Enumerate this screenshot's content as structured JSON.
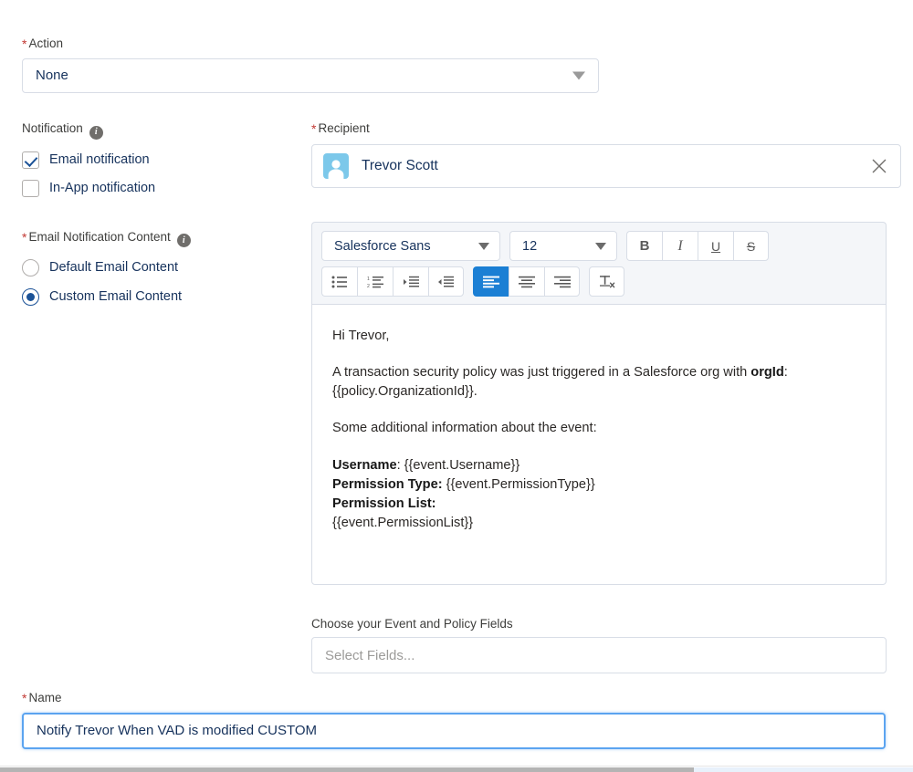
{
  "action": {
    "label": "Action",
    "required": true,
    "value": "None"
  },
  "notification": {
    "label": "Notification",
    "info_icon": "info-icon",
    "options": [
      {
        "label": "Email notification",
        "checked": true
      },
      {
        "label": "In-App notification",
        "checked": false
      }
    ]
  },
  "email_notification_content": {
    "label": "Email Notification Content",
    "required": true,
    "info_icon": "info-icon",
    "options": [
      {
        "label": "Default Email Content",
        "selected": false
      },
      {
        "label": "Custom Email Content",
        "selected": true
      }
    ]
  },
  "recipient": {
    "label": "Recipient",
    "required": true,
    "value": "Trevor Scott",
    "avatar_icon": "user-avatar-icon",
    "clear_icon": "close-icon"
  },
  "editor": {
    "font_family": "Salesforce Sans",
    "font_size": "12",
    "toolbar": {
      "bold": "B",
      "italic": "I",
      "underline": "U",
      "strikethrough": "S",
      "bulleted_list": "bulleted-list-icon",
      "numbered_list": "numbered-list-icon",
      "indent": "indent-icon",
      "outdent": "outdent-icon",
      "align_left": "align-left-icon",
      "align_center": "align-center-icon",
      "align_right": "align-right-icon",
      "remove_formatting": "remove-formatting-icon",
      "active_button": "align-left-icon"
    },
    "body": {
      "greeting": "Hi Trevor,",
      "paragraph_1_pre": "A transaction security policy was just triggered in a Salesforce org with ",
      "paragraph_1_bold": "orgId",
      "paragraph_1_post": ": {{policy.OrganizationId}}.",
      "paragraph_2": "Some additional information about the event:",
      "username_label": "Username",
      "username_value": ": {{event.Username}}",
      "permission_type_label": "Permission Type:",
      "permission_type_value": " {{event.PermissionType}}",
      "permission_list_label": "Permission List:",
      "permission_list_value": "{{event.PermissionList}}"
    }
  },
  "fields_picker": {
    "label": "Choose your Event and Policy Fields",
    "placeholder": "Select Fields..."
  },
  "name": {
    "label": "Name",
    "required": true,
    "value": "Notify Trevor  When VAD is modified CUSTOM"
  },
  "colors": {
    "accent_blue": "#1b7fd4",
    "required_red": "#c23934",
    "avatar_blue": "#7cc8ea",
    "border_gray": "#d8dde6",
    "toolbar_bg": "#f4f6f9",
    "focus_blue": "#5ba4f0"
  }
}
